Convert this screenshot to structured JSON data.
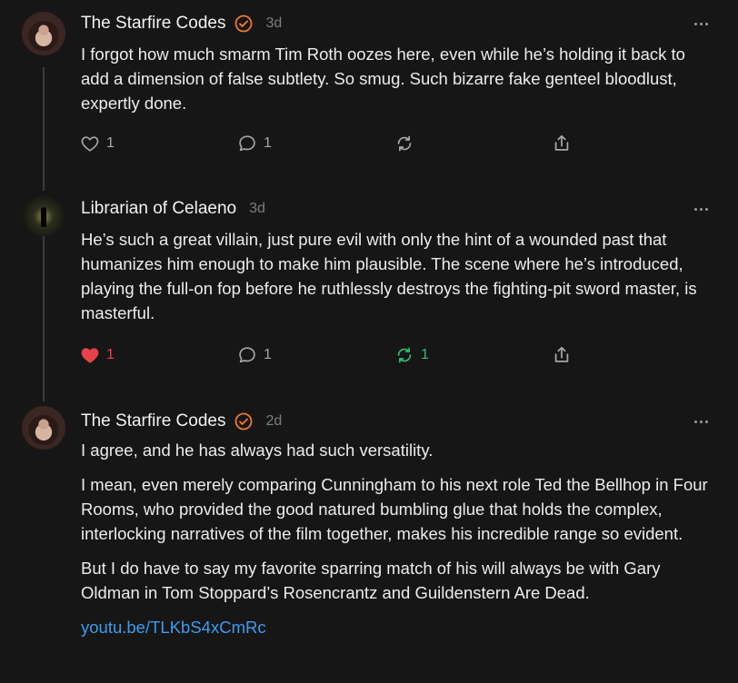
{
  "posts": [
    {
      "author": "The Starfire Codes",
      "verified": true,
      "time": "3d",
      "paragraphs": [
        "I forgot how much smarm Tim Roth oozes here, even while he’s holding it back to add a dimension of false subtlety. So smug. Such bizarre fake genteel bloodlust, expertly done."
      ],
      "actions": {
        "like_count": "1",
        "reply_count": "1",
        "repost_count": "",
        "liked": false,
        "reposted": false
      }
    },
    {
      "author": "Librarian of Celaeno",
      "verified": false,
      "time": "3d",
      "paragraphs": [
        "He’s such a great villain, just pure evil with only the hint of a wounded past that humanizes him enough to make him plausible. The scene where he’s introduced, playing the full-on fop before he ruthlessly destroys the fighting-pit sword master, is masterful."
      ],
      "actions": {
        "like_count": "1",
        "reply_count": "1",
        "repost_count": "1",
        "liked": true,
        "reposted": true
      }
    },
    {
      "author": "The Starfire Codes",
      "verified": true,
      "time": "2d",
      "paragraphs": [
        "I agree, and he has always had such versatility.",
        "I mean, even merely comparing Cunningham to his next role Ted the Bellhop in Four Rooms, who provided the good natured bumbling glue that holds the complex, interlocking narratives of the film together, makes his incredible range so evident.",
        "But I do have to say my favorite sparring match of his will always be with Gary Oldman in Tom Stoppard’s Rosencrantz and Guildenstern Are Dead."
      ],
      "link": "youtu.be/TLKbS4xCmRc"
    }
  ],
  "colors": {
    "background": "#161616",
    "verified": "#f07a2f",
    "liked": "#e8414a",
    "reposted": "#2fbf71",
    "link": "#3d9cf0"
  },
  "icons": [
    "heart-icon",
    "reply-icon",
    "repost-icon",
    "share-icon",
    "more-icon",
    "verified-icon"
  ]
}
